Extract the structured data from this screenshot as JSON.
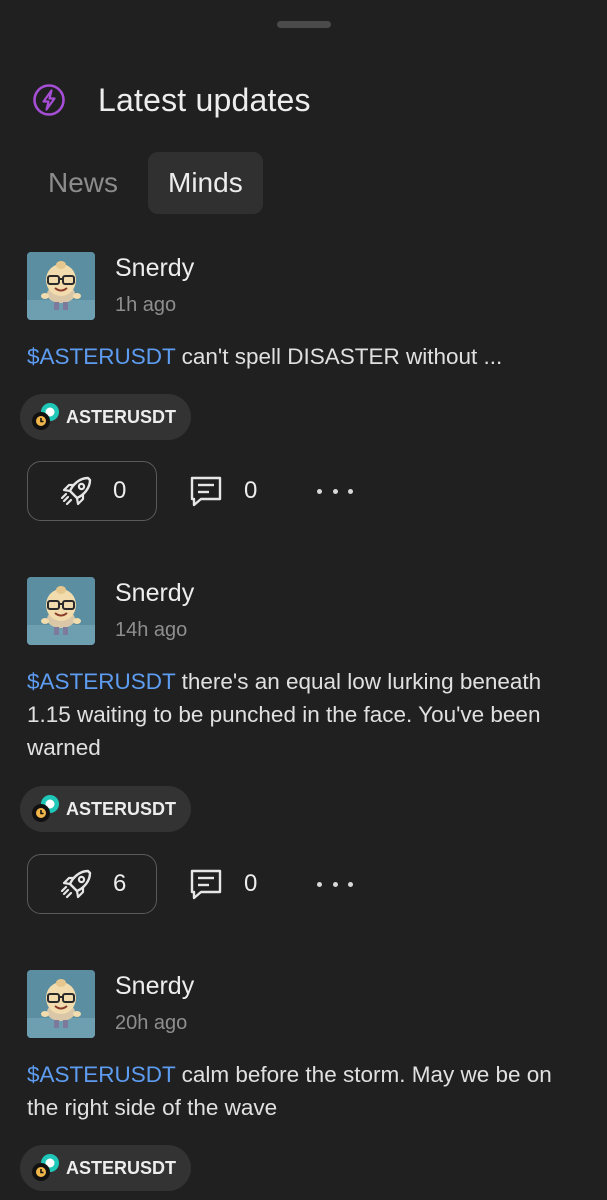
{
  "header": {
    "title": "Latest updates",
    "icon": "lightning-icon",
    "icon_color": "#a64ed6"
  },
  "tabs": [
    {
      "label": "News",
      "active": false
    },
    {
      "label": "Minds",
      "active": true
    }
  ],
  "colors": {
    "background": "#202020",
    "ticker_link": "#5d9cf0",
    "chip_background": "#333333"
  },
  "posts": [
    {
      "author": "Snerdy",
      "time": "1h ago",
      "ticker": "$ASTERUSDT",
      "text": " can't spell DISASTER without ...",
      "chip_label": "ASTERUSDT",
      "rocket_count": "0",
      "comment_count": "0"
    },
    {
      "author": "Snerdy",
      "time": "14h ago",
      "ticker": "$ASTERUSDT",
      "text": " there's an equal low lurking beneath 1.15 waiting to be punched in the face. You've been warned",
      "chip_label": "ASTERUSDT",
      "rocket_count": "6",
      "comment_count": "0"
    },
    {
      "author": "Snerdy",
      "time": "20h ago",
      "ticker": "$ASTERUSDT",
      "text": " calm before the storm. May we be on the right side of the wave",
      "chip_label": "ASTERUSDT"
    }
  ]
}
